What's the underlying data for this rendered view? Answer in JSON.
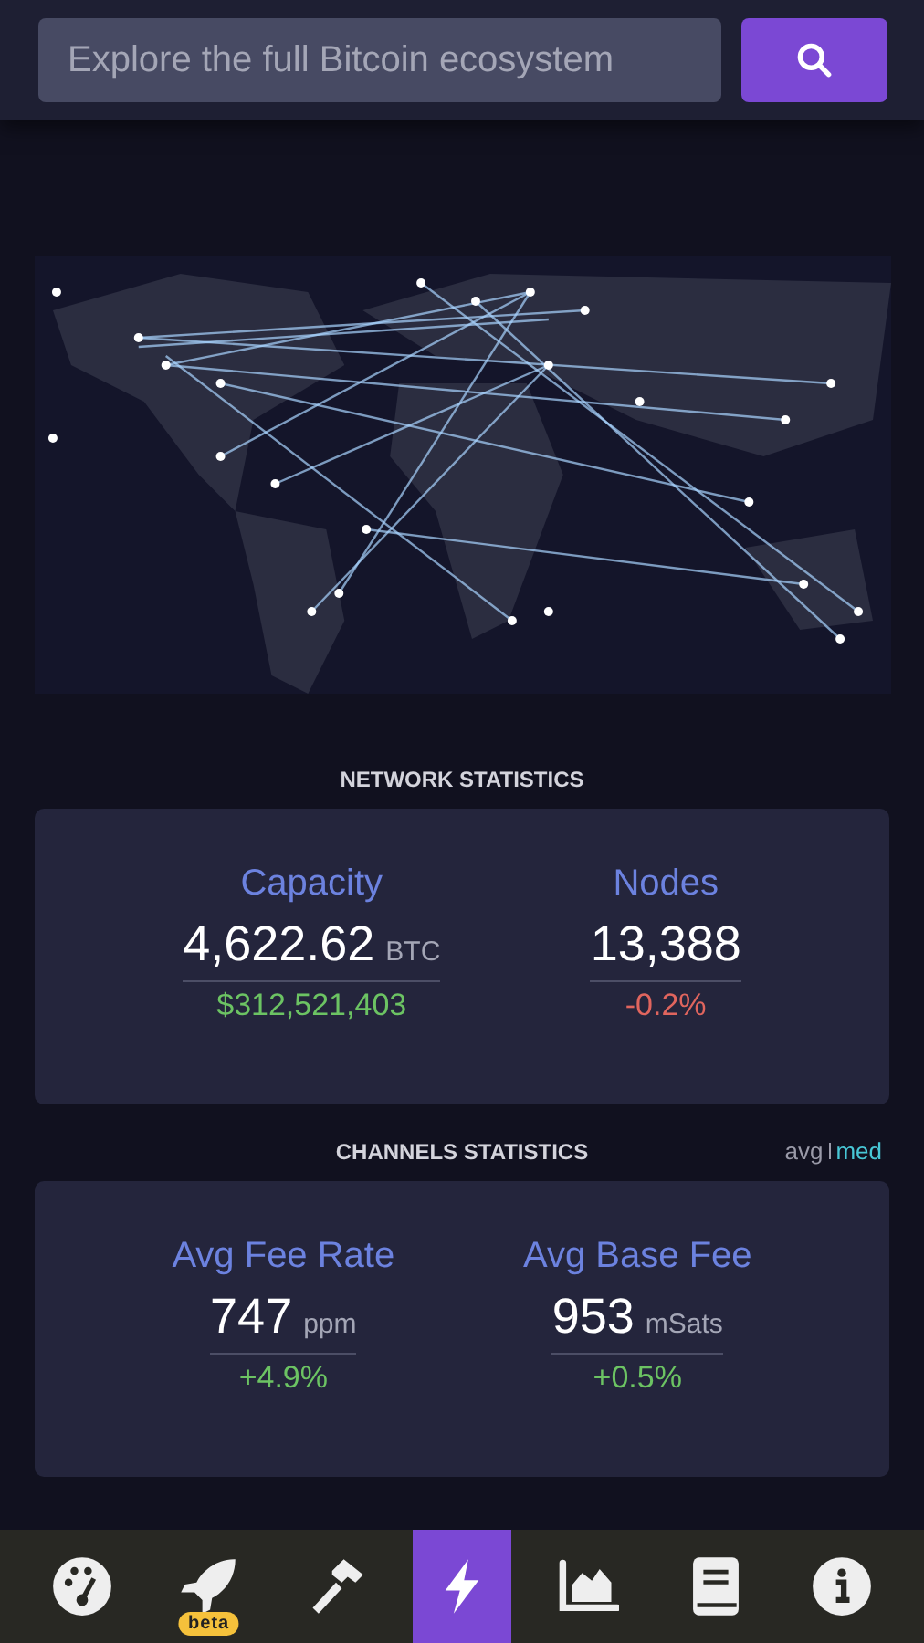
{
  "search": {
    "placeholder": "Explore the full Bitcoin ecosystem"
  },
  "sections": [
    {
      "title": "NETWORK STATISTICS",
      "stats": [
        {
          "label": "Capacity",
          "value": "4,622.62",
          "unit": "BTC",
          "sub": "$312,521,403",
          "color": "#6cc363"
        },
        {
          "label": "Nodes",
          "value": "13,388",
          "sub": "-0.2%",
          "color": "#e0655e"
        }
      ]
    },
    {
      "title": "CHANNELS STATISTICS",
      "toggle": [
        {
          "label": "avg",
          "selected": false
        },
        {
          "label": "med",
          "selected": true
        }
      ],
      "stats": [
        {
          "label": "Avg Fee Rate",
          "value": "747",
          "unit": "ppm",
          "sub": "+4.9%",
          "color": "#6cc363"
        },
        {
          "label": "Avg Base Fee",
          "value": "953",
          "unit": "mSats",
          "sub": "+0.5%",
          "color": "#6cc363"
        }
      ]
    }
  ],
  "nav": [
    {
      "selected": false
    },
    {
      "selected": false,
      "badge": "beta"
    },
    {
      "selected": false
    },
    {
      "selected": true
    },
    {
      "selected": false
    },
    {
      "selected": false
    },
    {
      "selected": false
    }
  ]
}
